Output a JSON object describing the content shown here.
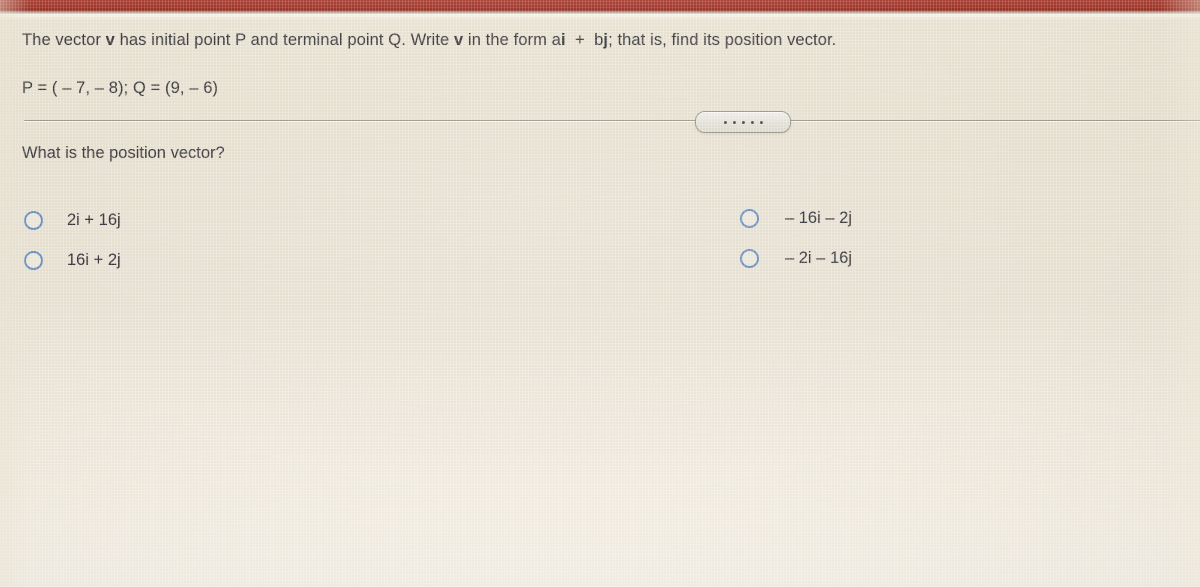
{
  "window": {
    "top_bar_color": "#a6392c",
    "background_color": "#eae4d6"
  },
  "problem": {
    "statement_part1": "The vector ",
    "statement_v1": "v",
    "statement_part2": " has initial point P and terminal point Q.  Write ",
    "statement_v2": "v",
    "statement_part3": " in the form a",
    "statement_i": "i",
    "statement_plus": "  +  b",
    "statement_j": "j",
    "statement_part4": "; that is, find its position vector.",
    "points": "P = ( – 7, – 8);   Q = (9, – 6)"
  },
  "divider": {
    "ellipsis_label": "·····",
    "dot_count": 5
  },
  "question": {
    "text": "What is the position vector?"
  },
  "options": {
    "left": [
      {
        "id": "option-a",
        "label": "2i + 16j",
        "selected": false
      },
      {
        "id": "option-b",
        "label": "16i + 2j",
        "selected": false
      }
    ],
    "right": [
      {
        "id": "option-c",
        "label": "– 16i – 2j",
        "selected": false
      },
      {
        "id": "option-d",
        "label": "– 2i – 16j",
        "selected": false
      }
    ],
    "radio_color": "#6d8fc0"
  }
}
